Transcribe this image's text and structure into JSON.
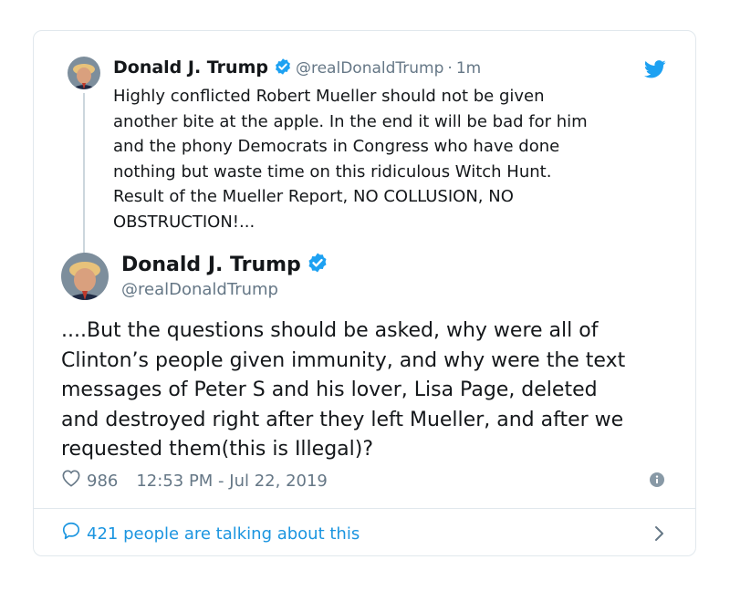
{
  "quoted_tweet": {
    "name": "Donald J. Trump",
    "handle": "@realDonaldTrump",
    "separator": "·",
    "time": "1m",
    "text": "Highly conflicted Robert Mueller should not be given\nanother bite at the apple. In the end it will be bad for him\nand the phony Democrats in Congress who have done\nnothing but waste time on this ridiculous Witch Hunt.\nResult of the Mueller Report, NO COLLUSION, NO\nOBSTRUCTION!..."
  },
  "main_tweet": {
    "name": "Donald J. Trump",
    "handle": "@realDonaldTrump",
    "text": "....But the questions should be asked, why were all of\nClinton’s people given immunity, and why were the text\nmessages of Peter S and his lover, Lisa Page, deleted\nand destroyed right after they left Mueller, and after we\nrequested them(this is Illegal)?",
    "likes": "986",
    "timestamp": "12:53 PM - Jul 22, 2019"
  },
  "footer": {
    "talking_label": "421 people are talking about this"
  },
  "colors": {
    "accent": "#1da1f2",
    "link": "#1b95e0",
    "muted": "#657786",
    "border": "#e1e8ed"
  },
  "icons": [
    "verified-badge-icon",
    "twitter-bird-icon",
    "heart-icon",
    "info-icon",
    "speech-bubble-icon",
    "chevron-right-icon"
  ]
}
